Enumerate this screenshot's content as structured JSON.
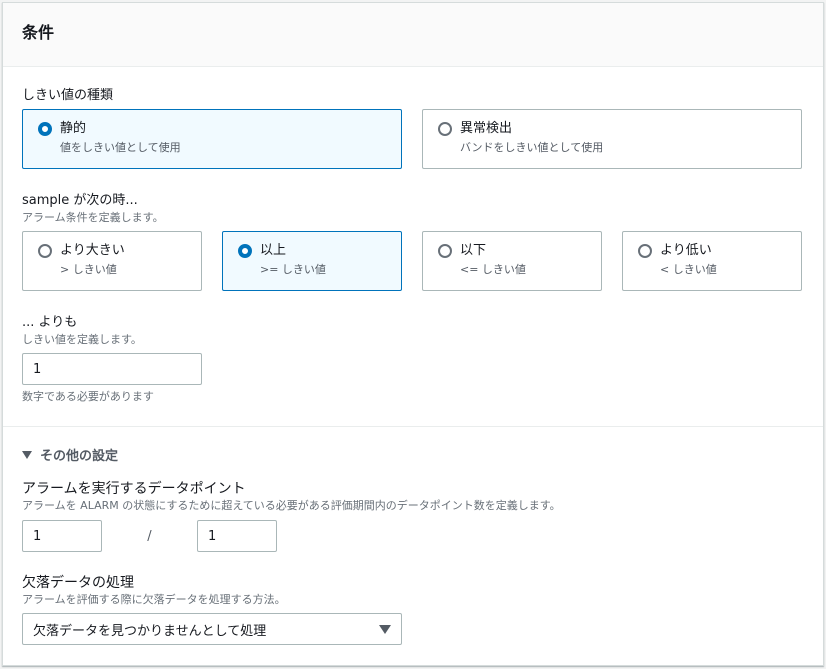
{
  "panel": {
    "title": "条件"
  },
  "threshold_type": {
    "label": "しきい値の種類",
    "options": [
      {
        "label": "静的",
        "desc": "値をしきい値として使用",
        "selected": true
      },
      {
        "label": "異常検出",
        "desc": "バンドをしきい値として使用",
        "selected": false
      }
    ]
  },
  "comparison": {
    "label": "sample が次の時...",
    "desc": "アラーム条件を定義します。",
    "options": [
      {
        "label": "より大きい",
        "desc": "> しきい値",
        "selected": false
      },
      {
        "label": "以上",
        "desc": ">= しきい値",
        "selected": true
      },
      {
        "label": "以下",
        "desc": "<= しきい値",
        "selected": false
      },
      {
        "label": "より低い",
        "desc": "< しきい値",
        "selected": false
      }
    ]
  },
  "threshold": {
    "label": "... よりも",
    "desc": "しきい値を定義します。",
    "value": "1",
    "hint": "数字である必要があります"
  },
  "additional": {
    "title": "その他の設定",
    "datapoints": {
      "label": "アラームを実行するデータポイント",
      "desc": "アラームを ALARM の状態にするために超えている必要がある評価期間内のデータポイント数を定義します。",
      "value1": "1",
      "separator": "/",
      "value2": "1"
    },
    "missing": {
      "label": "欠落データの処理",
      "desc": "アラームを評価する際に欠落データを処理する方法。",
      "selected": "欠落データを見つかりませんとして処理"
    }
  }
}
